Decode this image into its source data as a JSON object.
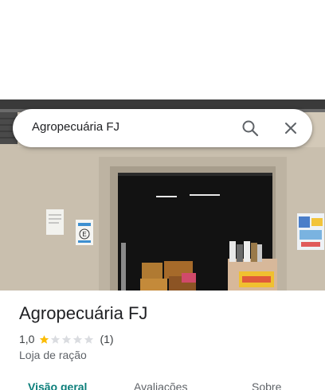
{
  "search": {
    "query": "Agropecuária FJ"
  },
  "place": {
    "name": "Agropecuária FJ",
    "rating": "1,0",
    "stars_filled": 1,
    "stars_total": 5,
    "review_count": "(1)",
    "category": "Loja de ração"
  },
  "tabs": [
    {
      "label": "Visão geral",
      "active": true
    },
    {
      "label": "Avaliações",
      "active": false
    },
    {
      "label": "Sobre",
      "active": false
    }
  ],
  "photo": {
    "sign_letter": "E"
  },
  "colors": {
    "accent": "#0b7e7a",
    "star": "#fbbc04",
    "star_empty": "#dadce0"
  }
}
